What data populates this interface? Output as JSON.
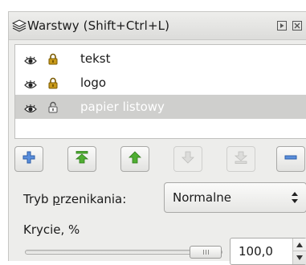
{
  "titlebar": {
    "title": "Warstwy (Shift+Ctrl+L)",
    "icon": "layers-icon",
    "buttons": [
      "menu-icon",
      "close-icon"
    ]
  },
  "layers": [
    {
      "name": "tekst",
      "visible": true,
      "locked": true,
      "selected": false
    },
    {
      "name": "logo",
      "visible": true,
      "locked": true,
      "selected": false
    },
    {
      "name": "papier listowy",
      "visible": true,
      "locked": false,
      "selected": true
    }
  ],
  "toolbar": {
    "buttons": [
      {
        "name": "add-layer-button",
        "icon": "plus-icon",
        "enabled": true
      },
      {
        "name": "raise-to-top-button",
        "icon": "arrow-top-icon",
        "enabled": true
      },
      {
        "name": "raise-layer-button",
        "icon": "arrow-up-icon",
        "enabled": true
      },
      {
        "name": "lower-layer-button",
        "icon": "arrow-down-icon",
        "enabled": false
      },
      {
        "name": "lower-to-bottom-button",
        "icon": "arrow-bottom-icon",
        "enabled": false
      },
      {
        "name": "remove-layer-button",
        "icon": "minus-icon",
        "enabled": true
      }
    ]
  },
  "blend": {
    "label_pre": "Tryb ",
    "label_underlined": "p",
    "label_post": "rzenikania:",
    "value": "Normalne"
  },
  "opacity": {
    "label": "Krycie, %",
    "value": "100,0",
    "fraction": 1.0
  },
  "colors": {
    "panel_bg": "#ededeb",
    "selected_row": "#cfcfcd",
    "accent_blue": "#3a6fc4",
    "accent_green": "#3f9a2a",
    "lock_gold": "#c99a1a"
  }
}
